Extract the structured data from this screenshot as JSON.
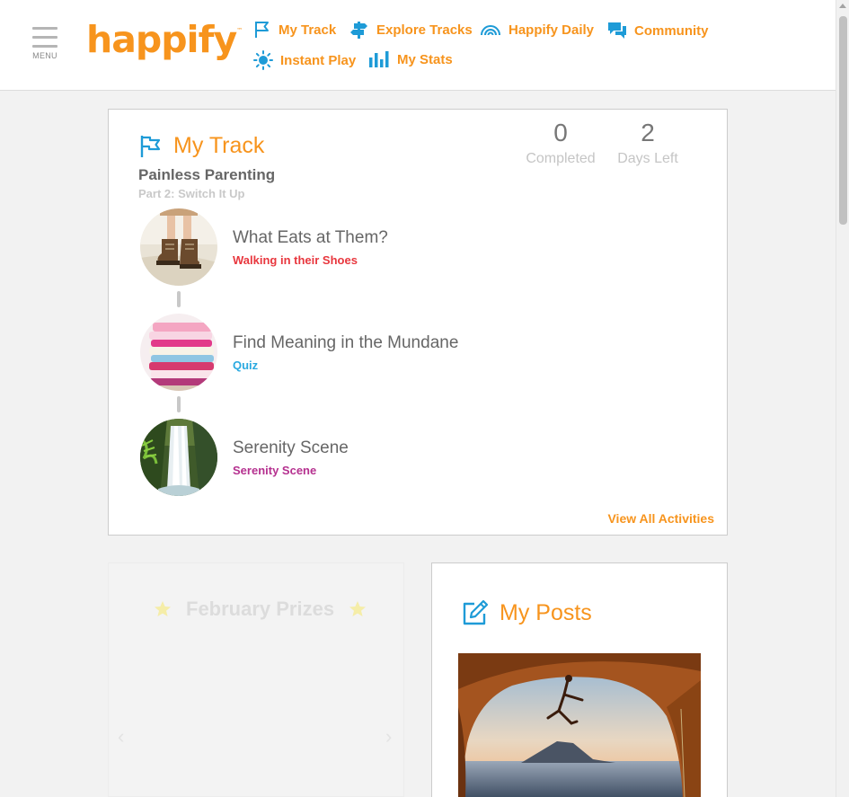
{
  "header": {
    "menu_label": "MENU",
    "logo": "happify",
    "logo_tm": "™",
    "nav": [
      {
        "label": "My Track",
        "icon": "flag-icon"
      },
      {
        "label": "Explore Tracks",
        "icon": "signpost-icon"
      },
      {
        "label": "Happify Daily",
        "icon": "rainbow-icon"
      },
      {
        "label": "Community",
        "icon": "chat-bubbles-icon"
      },
      {
        "label": "Instant Play",
        "icon": "sun-icon"
      },
      {
        "label": "My Stats",
        "icon": "bar-chart-icon"
      }
    ]
  },
  "track": {
    "title": "My Track",
    "name": "Painless Parenting",
    "part": "Part 2: Switch It Up",
    "stats": [
      {
        "value": "0",
        "label": "Completed"
      },
      {
        "value": "2",
        "label": "Days Left"
      }
    ],
    "activities": [
      {
        "title": "What Eats at Them?",
        "subtitle": "Walking in their Shoes",
        "color": "#e8373e",
        "image": "boots-photo"
      },
      {
        "title": "Find Meaning in the Mundane",
        "subtitle": "Quiz",
        "color": "#29a9e0",
        "image": "folded-clothes-photo"
      },
      {
        "title": "Serenity Scene",
        "subtitle": "Serenity Scene",
        "color": "#b5308f",
        "image": "waterfall-photo"
      }
    ],
    "view_all": "View All Activities"
  },
  "prizes": {
    "title": "February Prizes"
  },
  "posts": {
    "title": "My Posts",
    "image": "climber-photo"
  },
  "colors": {
    "brand_orange": "#f7941d",
    "nav_icon_blue": "#1e9bd7"
  }
}
